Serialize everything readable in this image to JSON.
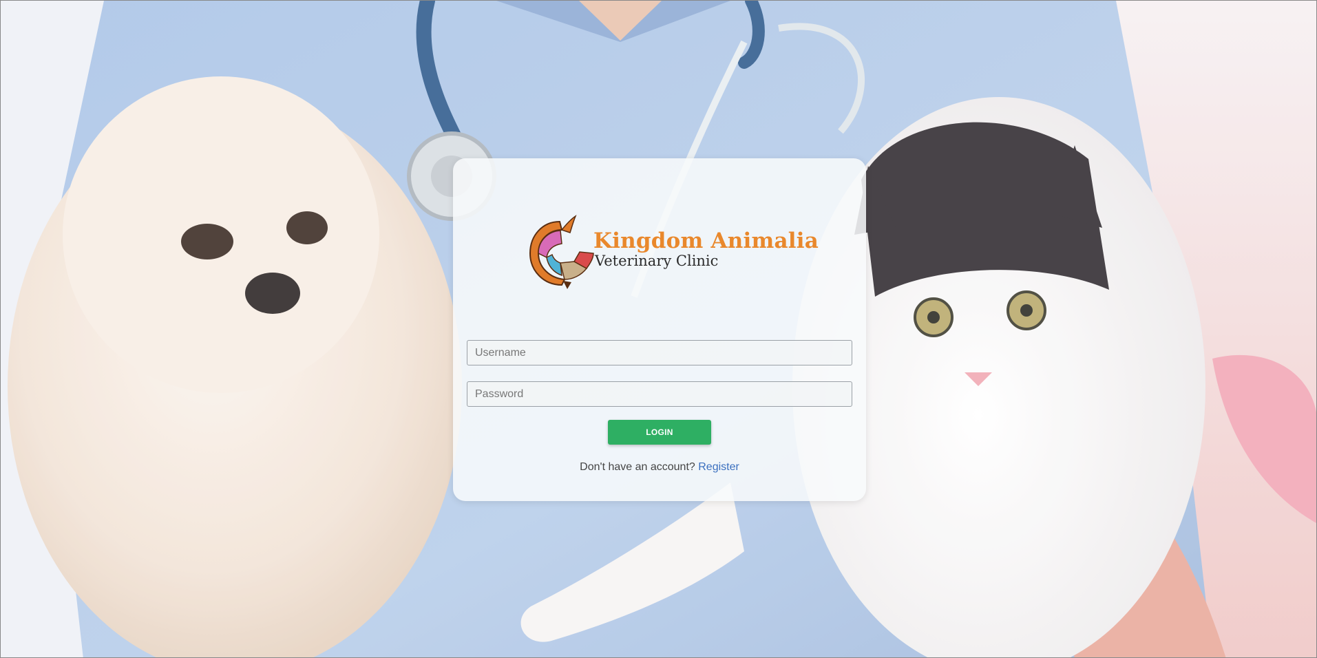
{
  "brand": {
    "title": "Kingdom Animalia",
    "subtitle": "Veterinary Clinic",
    "title_color": "#e9882c",
    "logo_icon": "animal-globe-logo-icon"
  },
  "login_form": {
    "username": {
      "value": "",
      "placeholder": "Username"
    },
    "password": {
      "value": "",
      "placeholder": "Password"
    },
    "login_label": "LOGIN",
    "login_color": "#2eaf63",
    "register_prompt": "Don't have an account?",
    "register_link": "Register",
    "link_color": "#3a6fbf"
  },
  "background": {
    "image": "veterinarian-holding-dog-and-cat-photo"
  }
}
